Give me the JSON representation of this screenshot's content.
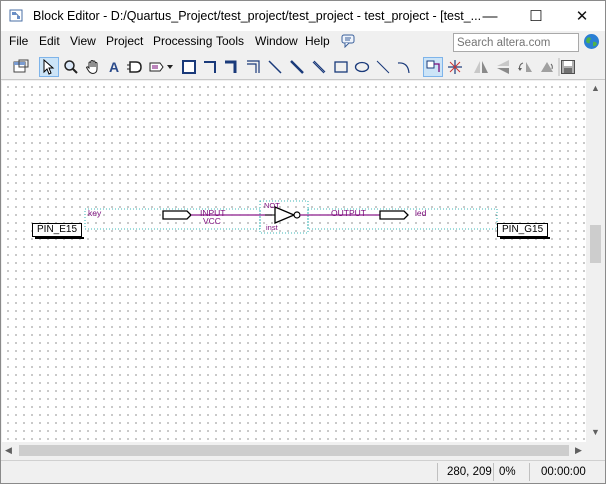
{
  "window": {
    "title": "Block Editor - D:/Quartus_Project/test_project/test_project - test_project - [test_...",
    "minimize": "—",
    "maximize": "☐",
    "close": "✕"
  },
  "menu": {
    "items": [
      {
        "label": "File"
      },
      {
        "label": "Edit"
      },
      {
        "label": "View"
      },
      {
        "label": "Project"
      },
      {
        "label": "Processing"
      },
      {
        "label": "Tools"
      },
      {
        "label": "Window"
      },
      {
        "label": "Help"
      }
    ],
    "search_placeholder": "Search altera.com"
  },
  "toolbar": {
    "tools": [
      {
        "icon": "detach-window-icon"
      },
      {
        "icon": "selection-tool-icon",
        "selected": true
      },
      {
        "icon": "zoom-tool-icon"
      },
      {
        "icon": "hand-tool-icon"
      },
      {
        "icon": "text-tool-icon"
      },
      {
        "icon": "symbol-tool-icon"
      },
      {
        "icon": "pin-tool-icon"
      },
      {
        "icon": "block-tool-icon"
      },
      {
        "icon": "orthogonal-node-tool-icon"
      },
      {
        "icon": "orthogonal-bus-tool-icon"
      },
      {
        "icon": "orthogonal-conduit-tool-icon"
      },
      {
        "icon": "diagonal-node-tool-icon"
      },
      {
        "icon": "diagonal-bus-tool-icon"
      },
      {
        "icon": "diagonal-conduit-tool-icon"
      },
      {
        "icon": "rectangle-tool-icon"
      },
      {
        "icon": "oval-tool-icon"
      },
      {
        "icon": "line-tool-icon"
      },
      {
        "icon": "arc-tool-icon"
      },
      {
        "icon": "rubberbanding-icon",
        "selected": true
      },
      {
        "icon": "partial-line-selection-icon"
      },
      {
        "icon": "flip-horizontal-icon"
      },
      {
        "icon": "flip-vertical-icon"
      },
      {
        "icon": "rotate-left-icon"
      },
      {
        "icon": "rotate-right-icon"
      },
      {
        "icon": "save-icon"
      }
    ]
  },
  "schematic": {
    "input_pin": {
      "name": "key",
      "type": "INPUT",
      "vcc": "VCC",
      "location": "PIN_E15"
    },
    "gate": {
      "type": "NOT",
      "instance": "inst"
    },
    "output_pin": {
      "name": "led",
      "type": "OUTPUT",
      "location": "PIN_G15"
    }
  },
  "status": {
    "coordinates": "280, 209",
    "percent": "0%",
    "time": "00:00:00"
  },
  "colors": {
    "wire": "#8b1a8b",
    "symbol_outline": "#000000",
    "selection_dots": "#00a0a0",
    "grid_dots": "#4a4a4a"
  }
}
